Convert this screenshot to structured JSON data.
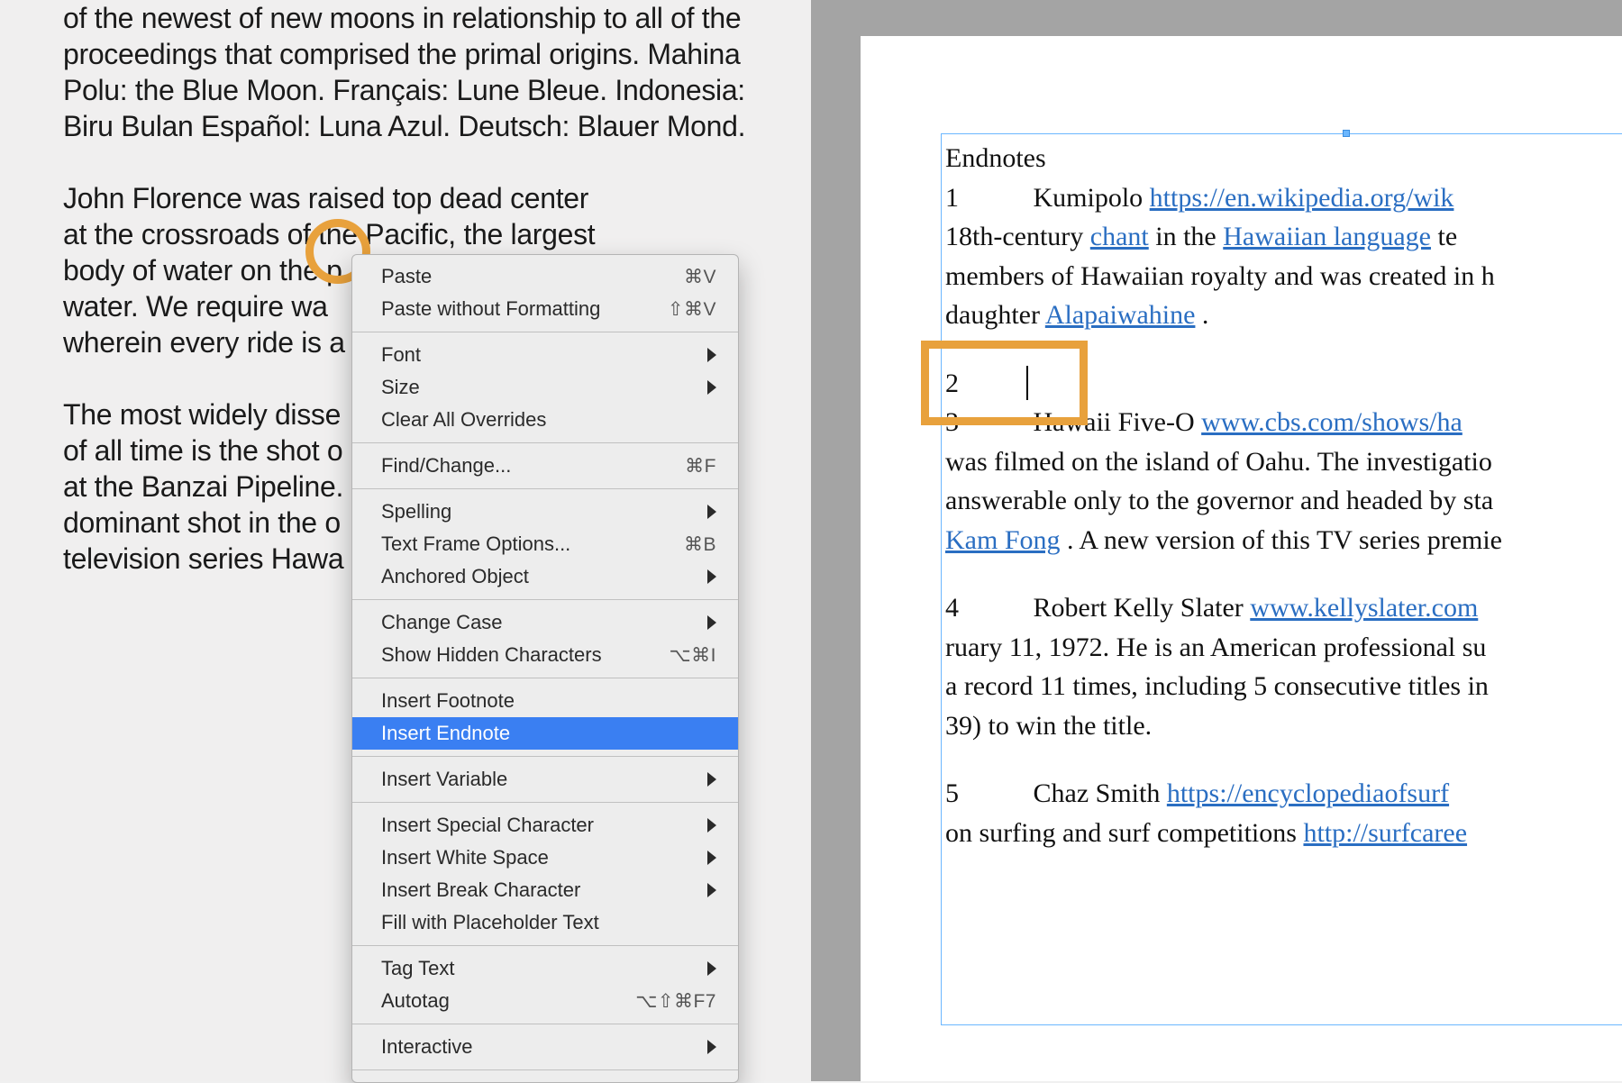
{
  "left_doc": {
    "p1": "of the newest of new moons in relationship to all of the proceedings that comprised the primal origins. Mahina Polu: the Blue Moon. Français: Lune Bleue. Indonesia: Biru Bulan Español: Luna Azul. Deutsch: Blauer Mond.",
    "p2_line1": "John Florence was raised top dead center",
    "p2_line2": "at the crossroads of the Pacific, the largest",
    "p2_line3": "body of water on the p",
    "p2_line4": "water. We require wa",
    "p2_line5": "wherein every ride is a",
    "p3_line1": "The most widely disse",
    "p3_line2": "of all time is the shot o",
    "p3_line3": "at the Banzai Pipeline.",
    "p3_line4": "dominant shot in the o",
    "p3_line5": "television series Hawa"
  },
  "context_menu": {
    "paste": {
      "label": "Paste",
      "shortcut": "⌘V"
    },
    "paste_nf": {
      "label": "Paste without Formatting",
      "shortcut": "⇧⌘V"
    },
    "font": {
      "label": "Font"
    },
    "size": {
      "label": "Size"
    },
    "clear_overrides": {
      "label": "Clear All Overrides"
    },
    "find_change": {
      "label": "Find/Change...",
      "shortcut": "⌘F"
    },
    "spelling": {
      "label": "Spelling"
    },
    "text_frame_opts": {
      "label": "Text Frame Options...",
      "shortcut": "⌘B"
    },
    "anchored_object": {
      "label": "Anchored Object"
    },
    "change_case": {
      "label": "Change Case"
    },
    "show_hidden": {
      "label": "Show Hidden Characters",
      "shortcut": "⌥⌘I"
    },
    "insert_footnote": {
      "label": "Insert Footnote"
    },
    "insert_endnote": {
      "label": "Insert Endnote"
    },
    "insert_variable": {
      "label": "Insert Variable"
    },
    "insert_special": {
      "label": "Insert Special Character"
    },
    "insert_whitespace": {
      "label": "Insert White Space"
    },
    "insert_break": {
      "label": "Insert Break Character"
    },
    "fill_placeholder": {
      "label": "Fill with Placeholder Text"
    },
    "tag_text": {
      "label": "Tag Text"
    },
    "autotag": {
      "label": "Autotag",
      "shortcut": "⌥⇧⌘F7"
    },
    "interactive": {
      "label": "Interactive"
    }
  },
  "endnotes": {
    "title": "Endnotes",
    "n1": {
      "num": "1",
      "lead": "Kumipolo ",
      "link_text": "https://en.wikipedia.org/wik",
      "link_href": "#",
      "cont1a": "18th-century ",
      "cont1_link1": "chant",
      "cont1b": " in the ",
      "cont1_link2": "Hawaiian language",
      "cont1c": " te",
      "cont2": "members of Hawaiian royalty and was created in h",
      "cont3a": "daughter ",
      "cont3_link": "Alapaiwahine",
      "cont3b": "."
    },
    "n2": {
      "num": "2"
    },
    "n3": {
      "num": "3",
      "lead": "Hawaii Five-O ",
      "link_text": "www.cbs.com/shows/ha",
      "cont1": "was filmed on the island of Oahu. The investigatio",
      "cont2": "answerable only to the governor and headed by sta",
      "cont3_link": "Kam Fong",
      "cont3b": ". A new version of this TV series premie"
    },
    "n4": {
      "num": "4",
      "lead": "Robert Kelly Slater ",
      "link_text": "www.kellyslater.com",
      "cont1": "ruary 11, 1972. He is an American professional su",
      "cont2": "a record 11 times, including 5 consecutive titles in",
      "cont3": "39) to win the title."
    },
    "n5": {
      "num": "5",
      "lead": "Chaz Smith ",
      "link_text": "https://encyclopediaofsurf",
      "cont1a": "on surfing and surf competitions ",
      "cont1_link": "http://surfcaree"
    }
  },
  "colors": {
    "highlight": "#e8a13c",
    "selection": "#3a7ff2",
    "frame_blue": "#6bb7ff",
    "link": "#2a6ec2"
  }
}
